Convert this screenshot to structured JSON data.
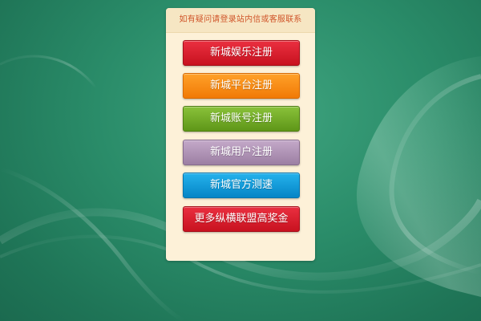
{
  "notice": {
    "text": "如有疑问请登录站内信或客服联系"
  },
  "buttons": [
    {
      "label": "新城娱乐注册",
      "color": "#d81e2c"
    },
    {
      "label": "新城平台注册",
      "color": "#f8890f"
    },
    {
      "label": "新城账号注册",
      "color": "#73ab27"
    },
    {
      "label": "新城用户注册",
      "color": "#b093b6"
    },
    {
      "label": "新城官方测速",
      "color": "#129ad8"
    },
    {
      "label": "更多纵横联盟高奖金",
      "color": "#d81e2c"
    }
  ],
  "theme": {
    "background": "#2a8c69",
    "panel": "#fdf1d8",
    "notice_text": "#d0552a"
  }
}
